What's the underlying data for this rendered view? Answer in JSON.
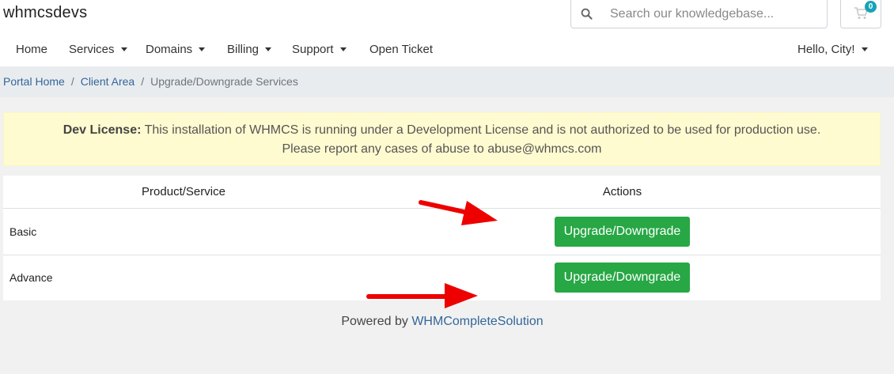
{
  "header": {
    "logo": "whmcsdevs",
    "search_placeholder": "Search our knowledgebase...",
    "cart_count": "0"
  },
  "nav": {
    "items": [
      {
        "label": "Home"
      },
      {
        "label": "Services"
      },
      {
        "label": "Domains"
      },
      {
        "label": "Billing"
      },
      {
        "label": "Support"
      },
      {
        "label": "Open Ticket"
      }
    ],
    "user": "Hello, City!"
  },
  "breadcrumb": {
    "items": [
      "Portal Home",
      "Client Area"
    ],
    "current": "Upgrade/Downgrade Services"
  },
  "license": {
    "label": "Dev License:",
    "text": "This installation of WHMCS is running under a Development License and is not authorized to be used for production use.",
    "line2": "Please report any cases of abuse to abuse@whmcs.com"
  },
  "table": {
    "columns": [
      "Product/Service",
      "Actions"
    ],
    "rows": [
      {
        "name": "Basic",
        "action": "Upgrade/Downgrade"
      },
      {
        "name": "Advance",
        "action": "Upgrade/Downgrade"
      }
    ]
  },
  "footer": {
    "prefix": "Powered by",
    "link": "WHMCompleteSolution"
  },
  "colors": {
    "accent_green": "#28a745",
    "link_blue": "#336699",
    "license_bg": "#fffbd0",
    "arrow_red": "#ee0000"
  }
}
